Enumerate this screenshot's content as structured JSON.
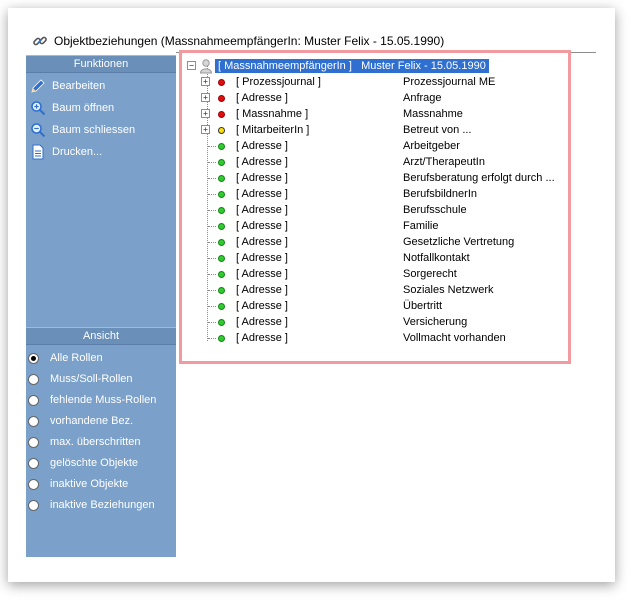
{
  "window": {
    "title": "Objektbeziehungen (MassnahmeempfängerIn: Muster Felix -  15.05.1990)"
  },
  "sidebar": {
    "functions_header": "Funktionen",
    "functions": [
      {
        "label": "Bearbeiten",
        "icon": "pencil-icon"
      },
      {
        "label": "Baum öffnen",
        "icon": "zoom-in-icon"
      },
      {
        "label": "Baum schliessen",
        "icon": "zoom-out-icon"
      },
      {
        "label": "Drucken...",
        "icon": "document-icon"
      }
    ],
    "view_header": "Ansicht",
    "view_options": [
      {
        "label": "Alle Rollen",
        "checked": true
      },
      {
        "label": "Muss/Soll-Rollen",
        "checked": false
      },
      {
        "label": "fehlende Muss-Rollen",
        "checked": false
      },
      {
        "label": "vorhandene Bez.",
        "checked": false
      },
      {
        "label": "max. überschritten",
        "checked": false
      },
      {
        "label": "gelöschte Objekte",
        "checked": false
      },
      {
        "label": "inaktive Objekte",
        "checked": false
      },
      {
        "label": "inaktive Beziehungen",
        "checked": false
      }
    ]
  },
  "tree": {
    "root": {
      "role": "[ MassnahmeempfängerIn ]",
      "name": "Muster Felix -  15.05.1990"
    },
    "items": [
      {
        "role": "[ Prozessjournal ]",
        "desc": "Prozessjournal ME",
        "status": "red",
        "expandable": true
      },
      {
        "role": "[ Adresse ]",
        "desc": "Anfrage",
        "status": "red",
        "expandable": true
      },
      {
        "role": "[ Massnahme ]",
        "desc": "Massnahme",
        "status": "red",
        "expandable": true
      },
      {
        "role": "[ MitarbeiterIn ]",
        "desc": "Betreut von ...",
        "status": "yellow",
        "expandable": true
      },
      {
        "role": "[ Adresse ]",
        "desc": "Arbeitgeber",
        "status": "green",
        "expandable": false
      },
      {
        "role": "[ Adresse ]",
        "desc": "Arzt/TherapeutIn",
        "status": "green",
        "expandable": false
      },
      {
        "role": "[ Adresse ]",
        "desc": "Berufsberatung erfolgt durch ...",
        "status": "green",
        "expandable": false
      },
      {
        "role": "[ Adresse ]",
        "desc": "BerufsbildnerIn",
        "status": "green",
        "expandable": false
      },
      {
        "role": "[ Adresse ]",
        "desc": "Berufsschule",
        "status": "green",
        "expandable": false
      },
      {
        "role": "[ Adresse ]",
        "desc": "Familie",
        "status": "green",
        "expandable": false
      },
      {
        "role": "[ Adresse ]",
        "desc": "Gesetzliche Vertretung",
        "status": "green",
        "expandable": false
      },
      {
        "role": "[ Adresse ]",
        "desc": "Notfallkontakt",
        "status": "green",
        "expandable": false
      },
      {
        "role": "[ Adresse ]",
        "desc": "Sorgerecht",
        "status": "green",
        "expandable": false
      },
      {
        "role": "[ Adresse ]",
        "desc": "Soziales Netzwerk",
        "status": "green",
        "expandable": false
      },
      {
        "role": "[ Adresse ]",
        "desc": "Übertritt",
        "status": "green",
        "expandable": false
      },
      {
        "role": "[ Adresse ]",
        "desc": "Versicherung",
        "status": "green",
        "expandable": false
      },
      {
        "role": "[ Adresse ]",
        "desc": "Vollmacht vorhanden",
        "status": "green",
        "expandable": false
      }
    ]
  },
  "colors": {
    "sidebar": "#7ba0c9",
    "header": "#6a8fb9",
    "selection": "#2f6fcf",
    "highlight_border": "#f19aa0"
  }
}
